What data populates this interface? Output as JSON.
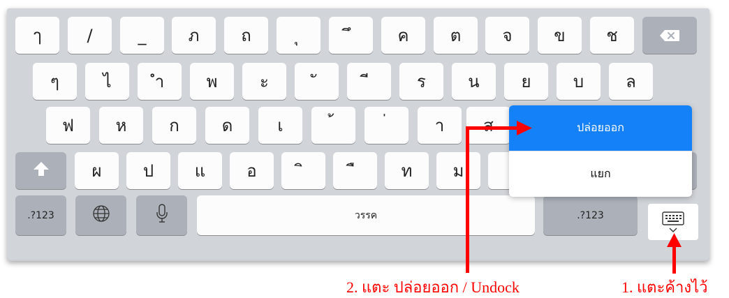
{
  "keyboard": {
    "row1": [
      "ๅ",
      "/",
      "_",
      "ภ",
      "ถ",
      "ุ",
      "ึ",
      "ค",
      "ต",
      "จ",
      "ข",
      "ช"
    ],
    "row2": [
      "ๆ",
      "ไ",
      "ำ",
      "พ",
      "ะ",
      "ั",
      "ี",
      "ร",
      "น",
      "ย",
      "บ",
      "ล"
    ],
    "row3": [
      "ฟ",
      "ห",
      "ก",
      "ด",
      "เ",
      "้",
      "่",
      "า",
      "ส"
    ],
    "row4": [
      "ผ",
      "ป",
      "แ",
      "อ",
      "ิ",
      "ื",
      "ท",
      "ม"
    ],
    "bottom": {
      "numbers_left": ".?123",
      "space": "วรรค",
      "numbers_right": ".?123"
    },
    "icons": {
      "delete": "backspace-icon",
      "shift": "shift-arrow-icon",
      "globe": "globe-icon",
      "mic": "microphone-icon",
      "hide": "keyboard-hide-icon"
    }
  },
  "popup_menu": {
    "undock": "ปล่อยออก",
    "split": "แยก",
    "selected_color": "#1581f9"
  },
  "annotations": {
    "step1": "1. แตะค้างไว้",
    "step2": "2. แตะ ปล่อยออก / Undock",
    "color": "#ff0000"
  }
}
